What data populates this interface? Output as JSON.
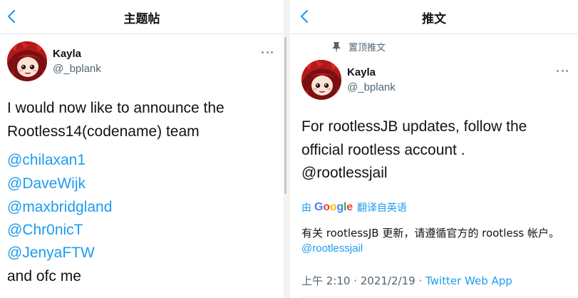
{
  "left": {
    "title": "主题帖",
    "author": {
      "name": "Kayla",
      "handle": "@_bplank"
    },
    "tweet_lines": [
      {
        "text": "I would now like to announce the",
        "type": "text"
      },
      {
        "text": "Rootless14(codename) team",
        "type": "text"
      },
      {
        "text": "@chilaxan1",
        "type": "mention"
      },
      {
        "text": "@DaveWijk",
        "type": "mention"
      },
      {
        "text": "@maxbridgland",
        "type": "mention"
      },
      {
        "text": "@Chr0nicT",
        "type": "mention"
      },
      {
        "text": "@JenyaFTW",
        "type": "mention"
      },
      {
        "text": "and ofc me",
        "type": "text"
      }
    ]
  },
  "right": {
    "title": "推文",
    "pinned_label": "置顶推文",
    "author": {
      "name": "Kayla",
      "handle": "@_bplank"
    },
    "tweet_lines": [
      {
        "text": "For rootlessJB updates, follow the",
        "type": "text"
      },
      {
        "text": "official rootless account .",
        "type": "text"
      },
      {
        "text": "@rootlessjail",
        "type": "mention"
      }
    ],
    "translate": {
      "prefix": "由",
      "brand": "Google",
      "suffix": "翻译自英语"
    },
    "translated_text": "有关 rootlessJB 更新，请遵循官方的 rootless 帐户。",
    "translated_mention": "@rootlessjail",
    "meta": {
      "time": "上午 2:10",
      "sep": " · ",
      "date": "2021/2/19",
      "source": "Twitter Web App"
    }
  },
  "colors": {
    "accent": "#1d9bf0",
    "text": "#0f1419",
    "muted": "#536471"
  },
  "icons": {
    "back": "chevron-left-icon",
    "more": "more-dots-icon",
    "pin": "pin-icon"
  }
}
